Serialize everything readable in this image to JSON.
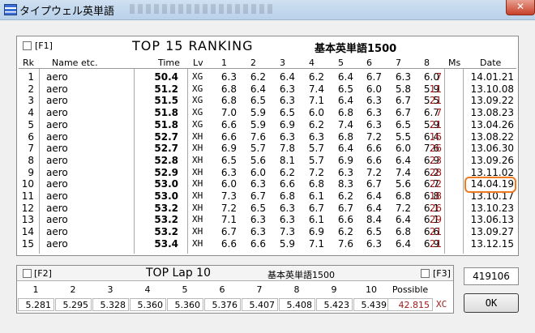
{
  "window": {
    "title": "タイプウェル英単語"
  },
  "ranking": {
    "f1_label": "[F1]",
    "title": "TOP 15 RANKING",
    "subtitle": "基本英単語1500",
    "headers": {
      "rk": "Rk",
      "name": "Name etc.",
      "time": "Time",
      "lv": "Lv",
      "s1": "1",
      "s2": "2",
      "s3": "3",
      "s4": "4",
      "s5": "5",
      "s6": "6",
      "s7": "7",
      "s8": "8",
      "ms": "Ms",
      "date": "Date"
    },
    "rows": [
      {
        "rk": "1",
        "name": "aero",
        "time": "50.4",
        "lv": "XG",
        "s": [
          "6.3",
          "6.2",
          "6.4",
          "6.2",
          "6.4",
          "6.7",
          "6.3",
          "6.0"
        ],
        "ms": "7",
        "date": "14.01.21"
      },
      {
        "rk": "2",
        "name": "aero",
        "time": "51.2",
        "lv": "XG",
        "s": [
          "6.8",
          "6.4",
          "6.3",
          "7.4",
          "6.5",
          "6.0",
          "5.8",
          "5.9"
        ],
        "ms": "11",
        "date": "13.10.08"
      },
      {
        "rk": "3",
        "name": "aero",
        "time": "51.5",
        "lv": "XG",
        "s": [
          "6.8",
          "6.5",
          "6.3",
          "7.1",
          "6.4",
          "6.3",
          "6.7",
          "5.5"
        ],
        "ms": "21",
        "date": "13.09.22"
      },
      {
        "rk": "4",
        "name": "aero",
        "time": "51.8",
        "lv": "XG",
        "s": [
          "7.0",
          "5.9",
          "6.5",
          "6.0",
          "6.8",
          "6.3",
          "6.7",
          "6.7"
        ],
        "ms": "7",
        "date": "13.08.23"
      },
      {
        "rk": "5",
        "name": "aero",
        "time": "51.8",
        "lv": "XG",
        "s": [
          "6.6",
          "5.9",
          "6.9",
          "6.2",
          "7.4",
          "6.3",
          "6.5",
          "5.9"
        ],
        "ms": "21",
        "date": "13.04.26"
      },
      {
        "rk": "6",
        "name": "aero",
        "time": "52.7",
        "lv": "XH",
        "s": [
          "6.6",
          "7.6",
          "6.3",
          "6.3",
          "6.8",
          "7.2",
          "5.5",
          "6.4"
        ],
        "ms": "16",
        "date": "13.08.22"
      },
      {
        "rk": "7",
        "name": "aero",
        "time": "52.7",
        "lv": "XH",
        "s": [
          "6.9",
          "5.7",
          "7.8",
          "5.7",
          "6.4",
          "6.6",
          "6.0",
          "7.6"
        ],
        "ms": "26",
        "date": "13.06.30"
      },
      {
        "rk": "8",
        "name": "aero",
        "time": "52.8",
        "lv": "XH",
        "s": [
          "6.5",
          "5.6",
          "8.1",
          "5.7",
          "6.9",
          "6.6",
          "6.4",
          "6.9"
        ],
        "ms": "23",
        "date": "13.09.26"
      },
      {
        "rk": "9",
        "name": "aero",
        "time": "52.9",
        "lv": "XH",
        "s": [
          "6.3",
          "6.0",
          "6.2",
          "7.2",
          "6.3",
          "7.2",
          "7.4",
          "6.2"
        ],
        "ms": "28",
        "date": "13.11.02"
      },
      {
        "rk": "10",
        "name": "aero",
        "time": "53.0",
        "lv": "XH",
        "s": [
          "6.0",
          "6.3",
          "6.6",
          "6.8",
          "8.3",
          "6.7",
          "5.6",
          "6.7"
        ],
        "ms": "22",
        "date": "14.04.19"
      },
      {
        "rk": "11",
        "name": "aero",
        "time": "53.0",
        "lv": "XH",
        "s": [
          "7.3",
          "6.7",
          "6.8",
          "6.1",
          "6.2",
          "6.4",
          "6.8",
          "6.8"
        ],
        "ms": "18",
        "date": "13.10.17"
      },
      {
        "rk": "12",
        "name": "aero",
        "time": "53.2",
        "lv": "XH",
        "s": [
          "7.2",
          "6.5",
          "6.3",
          "6.7",
          "6.7",
          "6.4",
          "7.2",
          "6.1"
        ],
        "ms": "26",
        "date": "13.10.23"
      },
      {
        "rk": "13",
        "name": "aero",
        "time": "53.2",
        "lv": "XH",
        "s": [
          "7.1",
          "6.3",
          "6.3",
          "6.1",
          "6.6",
          "8.4",
          "6.4",
          "6.1"
        ],
        "ms": "29",
        "date": "13.06.13"
      },
      {
        "rk": "14",
        "name": "aero",
        "time": "53.2",
        "lv": "XH",
        "s": [
          "6.7",
          "6.3",
          "7.3",
          "6.9",
          "6.2",
          "6.5",
          "6.8",
          "6.6"
        ],
        "ms": "21",
        "date": "13.09.27"
      },
      {
        "rk": "15",
        "name": "aero",
        "time": "53.4",
        "lv": "XH",
        "s": [
          "6.6",
          "6.6",
          "5.9",
          "7.1",
          "7.6",
          "6.3",
          "6.4",
          "6.9"
        ],
        "ms": "21",
        "date": "13.12.15"
      }
    ]
  },
  "lap": {
    "f2_label": "[F2]",
    "f3_label": "[F3]",
    "title": "TOP Lap 10",
    "subtitle": "基本英単語1500",
    "headers": [
      "1",
      "2",
      "3",
      "4",
      "5",
      "6",
      "7",
      "8",
      "9",
      "10"
    ],
    "possible_label": "Possible",
    "values": [
      "5.281",
      "5.295",
      "5.328",
      "5.360",
      "5.360",
      "5.376",
      "5.407",
      "5.408",
      "5.423",
      "5.439"
    ],
    "possible_value": "42.815",
    "possible_level": "XC"
  },
  "score": "419106",
  "ok_button": "OK",
  "colors": {
    "highlight": "#f07a20",
    "ms_text": "#a01a1a"
  }
}
